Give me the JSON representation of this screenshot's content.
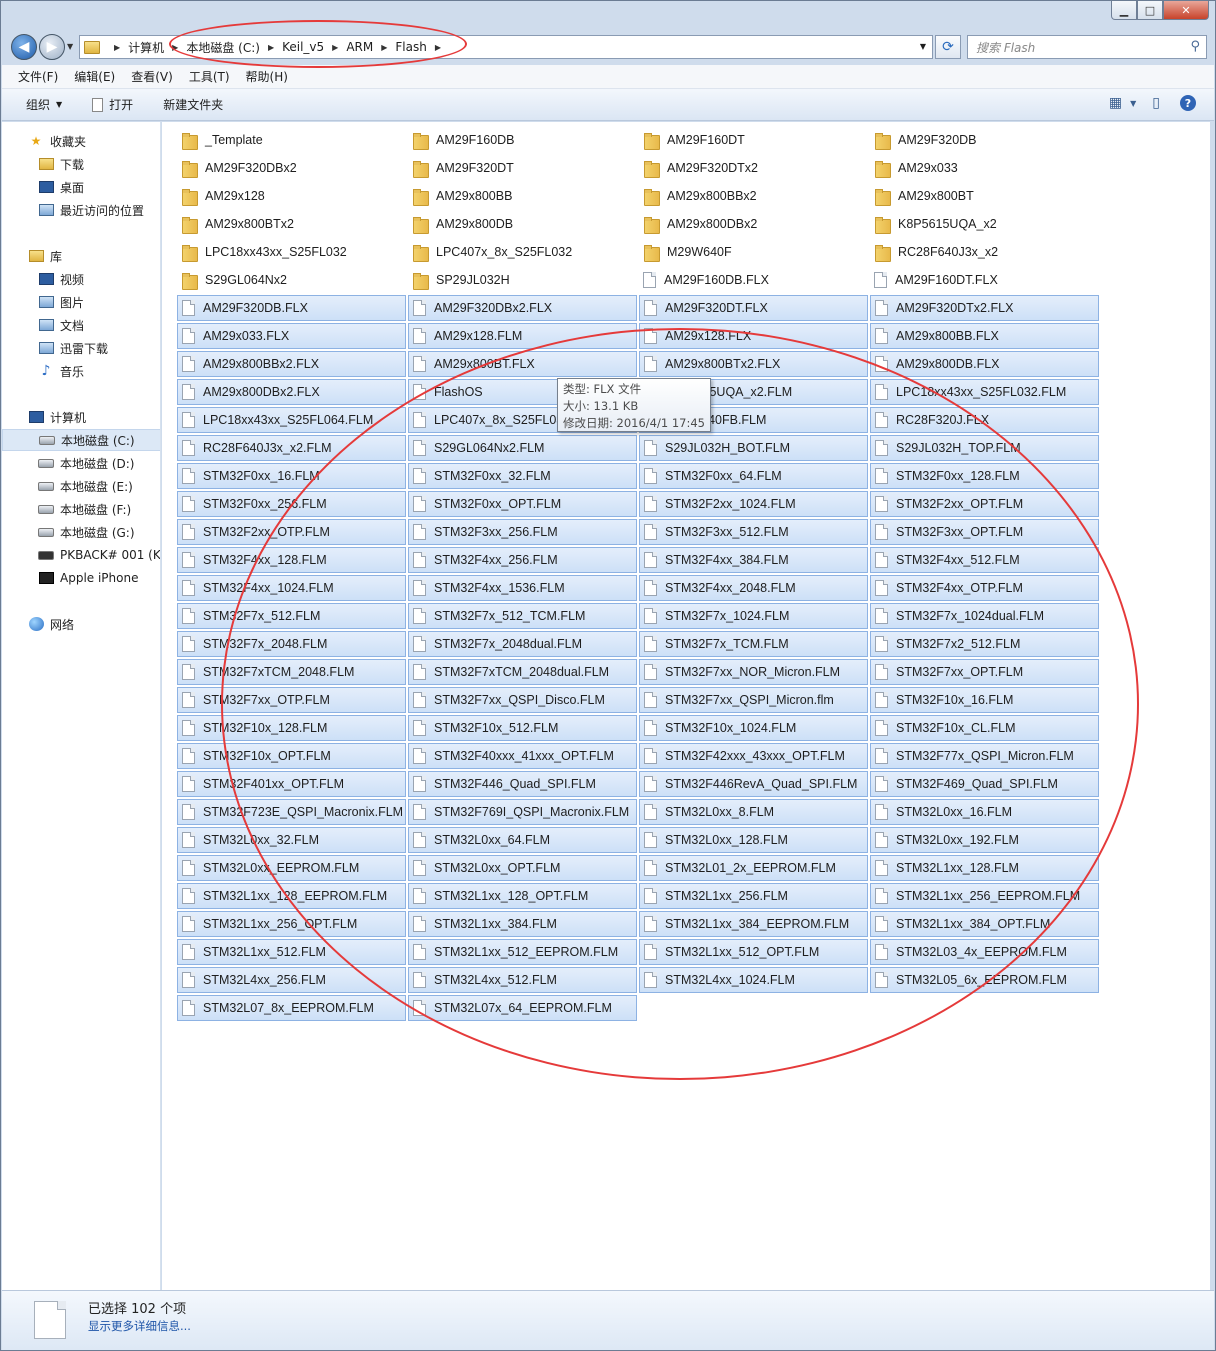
{
  "window": {
    "minimize": "▁",
    "maximize": "□",
    "close": "✕"
  },
  "address": {
    "crumbs": [
      "计算机",
      "本地磁盘 (C:)",
      "Keil_v5",
      "ARM",
      "Flash"
    ]
  },
  "search": {
    "placeholder": "搜索 Flash"
  },
  "menu": [
    "文件(F)",
    "编辑(E)",
    "查看(V)",
    "工具(T)",
    "帮助(H)"
  ],
  "toolbar": {
    "organize": "组织",
    "open": "打开",
    "new_folder": "新建文件夹"
  },
  "sidebar": {
    "favorites": "收藏夹",
    "downloads": "下载",
    "desktop": "桌面",
    "recent": "最近访问的位置",
    "libraries": "库",
    "videos": "视频",
    "pictures": "图片",
    "documents": "文档",
    "thunder": "迅雷下载",
    "music": "音乐",
    "computer": "计算机",
    "drive_c": "本地磁盘 (C:)",
    "drive_d": "本地磁盘 (D:)",
    "drive_e": "本地磁盘 (E:)",
    "drive_f": "本地磁盘 (F:)",
    "drive_g": "本地磁盘 (G:)",
    "pkback": "PKBACK# 001 (K:",
    "iphone": "Apple iPhone",
    "network": "网络"
  },
  "files": [
    {
      "name": "_Template",
      "type": "folder",
      "selected": false
    },
    {
      "name": "AM29F160DB",
      "type": "folder",
      "selected": false
    },
    {
      "name": "AM29F160DT",
      "type": "folder",
      "selected": false
    },
    {
      "name": "AM29F320DB",
      "type": "folder",
      "selected": false
    },
    {
      "name": "AM29F320DBx2",
      "type": "folder",
      "selected": false
    },
    {
      "name": "AM29F320DT",
      "type": "folder",
      "selected": false
    },
    {
      "name": "AM29F320DTx2",
      "type": "folder",
      "selected": false
    },
    {
      "name": "AM29x033",
      "type": "folder",
      "selected": false
    },
    {
      "name": "AM29x128",
      "type": "folder",
      "selected": false
    },
    {
      "name": "AM29x800BB",
      "type": "folder",
      "selected": false
    },
    {
      "name": "AM29x800BBx2",
      "type": "folder",
      "selected": false
    },
    {
      "name": "AM29x800BT",
      "type": "folder",
      "selected": false
    },
    {
      "name": "AM29x800BTx2",
      "type": "folder",
      "selected": false
    },
    {
      "name": "AM29x800DB",
      "type": "folder",
      "selected": false
    },
    {
      "name": "AM29x800DBx2",
      "type": "folder",
      "selected": false
    },
    {
      "name": "K8P5615UQA_x2",
      "type": "folder",
      "selected": false
    },
    {
      "name": "LPC18xx43xx_S25FL032",
      "type": "folder",
      "selected": false
    },
    {
      "name": "LPC407x_8x_S25FL032",
      "type": "folder",
      "selected": false
    },
    {
      "name": "M29W640F",
      "type": "folder",
      "selected": false
    },
    {
      "name": "RC28F640J3x_x2",
      "type": "folder",
      "selected": false
    },
    {
      "name": "S29GL064Nx2",
      "type": "folder",
      "selected": false
    },
    {
      "name": "SP29JL032H",
      "type": "folder",
      "selected": false
    },
    {
      "name": "AM29F160DB.FLX",
      "type": "file",
      "selected": false
    },
    {
      "name": "AM29F160DT.FLX",
      "type": "file",
      "selected": false
    },
    {
      "name": "AM29F320DB.FLX",
      "type": "file",
      "selected": true
    },
    {
      "name": "AM29F320DBx2.FLX",
      "type": "file",
      "selected": true
    },
    {
      "name": "AM29F320DT.FLX",
      "type": "file",
      "selected": true
    },
    {
      "name": "AM29F320DTx2.FLX",
      "type": "file",
      "selected": true
    },
    {
      "name": "AM29x033.FLX",
      "type": "file",
      "selected": true
    },
    {
      "name": "AM29x128.FLM",
      "type": "file",
      "selected": true
    },
    {
      "name": "AM29x128.FLX",
      "type": "file",
      "selected": true
    },
    {
      "name": "AM29x800BB.FLX",
      "type": "file",
      "selected": true
    },
    {
      "name": "AM29x800BBx2.FLX",
      "type": "file",
      "selected": true
    },
    {
      "name": "AM29x800BT.FLX",
      "type": "file",
      "selected": true
    },
    {
      "name": "AM29x800BTx2.FLX",
      "type": "file",
      "selected": true
    },
    {
      "name": "AM29x800DB.FLX",
      "type": "file",
      "selected": true
    },
    {
      "name": "AM29x800DBx2.FLX",
      "type": "file",
      "selected": true
    },
    {
      "name": "FlashOS",
      "type": "file",
      "selected": true
    },
    {
      "name": "K8P5615UQA_x2.FLM",
      "type": "file",
      "selected": true
    },
    {
      "name": "LPC18xx43xx_S25FL032.FLM",
      "type": "file",
      "selected": true
    },
    {
      "name": "LPC18xx43xx_S25FL064.FLM",
      "type": "file",
      "selected": true
    },
    {
      "name": "LPC407x_8x_S25FL032.FLM",
      "type": "file",
      "selected": true
    },
    {
      "name": "M29W640FB.FLM",
      "type": "file",
      "selected": true
    },
    {
      "name": "RC28F320J.FLX",
      "type": "file",
      "selected": true
    },
    {
      "name": "RC28F640J3x_x2.FLM",
      "type": "file",
      "selected": true
    },
    {
      "name": "S29GL064Nx2.FLM",
      "type": "file",
      "selected": true
    },
    {
      "name": "S29JL032H_BOT.FLM",
      "type": "file",
      "selected": true
    },
    {
      "name": "S29JL032H_TOP.FLM",
      "type": "file",
      "selected": true
    },
    {
      "name": "STM32F0xx_16.FLM",
      "type": "file",
      "selected": true
    },
    {
      "name": "STM32F0xx_32.FLM",
      "type": "file",
      "selected": true
    },
    {
      "name": "STM32F0xx_64.FLM",
      "type": "file",
      "selected": true
    },
    {
      "name": "STM32F0xx_128.FLM",
      "type": "file",
      "selected": true
    },
    {
      "name": "STM32F0xx_256.FLM",
      "type": "file",
      "selected": true
    },
    {
      "name": "STM32F0xx_OPT.FLM",
      "type": "file",
      "selected": true
    },
    {
      "name": "STM32F2xx_1024.FLM",
      "type": "file",
      "selected": true
    },
    {
      "name": "STM32F2xx_OPT.FLM",
      "type": "file",
      "selected": true
    },
    {
      "name": "STM32F2xx_OTP.FLM",
      "type": "file",
      "selected": true
    },
    {
      "name": "STM32F3xx_256.FLM",
      "type": "file",
      "selected": true
    },
    {
      "name": "STM32F3xx_512.FLM",
      "type": "file",
      "selected": true
    },
    {
      "name": "STM32F3xx_OPT.FLM",
      "type": "file",
      "selected": true
    },
    {
      "name": "STM32F4xx_128.FLM",
      "type": "file",
      "selected": true
    },
    {
      "name": "STM32F4xx_256.FLM",
      "type": "file",
      "selected": true
    },
    {
      "name": "STM32F4xx_384.FLM",
      "type": "file",
      "selected": true
    },
    {
      "name": "STM32F4xx_512.FLM",
      "type": "file",
      "selected": true
    },
    {
      "name": "STM32F4xx_1024.FLM",
      "type": "file",
      "selected": true
    },
    {
      "name": "STM32F4xx_1536.FLM",
      "type": "file",
      "selected": true
    },
    {
      "name": "STM32F4xx_2048.FLM",
      "type": "file",
      "selected": true
    },
    {
      "name": "STM32F4xx_OTP.FLM",
      "type": "file",
      "selected": true
    },
    {
      "name": "STM32F7x_512.FLM",
      "type": "file",
      "selected": true
    },
    {
      "name": "STM32F7x_512_TCM.FLM",
      "type": "file",
      "selected": true
    },
    {
      "name": "STM32F7x_1024.FLM",
      "type": "file",
      "selected": true
    },
    {
      "name": "STM32F7x_1024dual.FLM",
      "type": "file",
      "selected": true
    },
    {
      "name": "STM32F7x_2048.FLM",
      "type": "file",
      "selected": true
    },
    {
      "name": "STM32F7x_2048dual.FLM",
      "type": "file",
      "selected": true
    },
    {
      "name": "STM32F7x_TCM.FLM",
      "type": "file",
      "selected": true
    },
    {
      "name": "STM32F7x2_512.FLM",
      "type": "file",
      "selected": true
    },
    {
      "name": "STM32F7xTCM_2048.FLM",
      "type": "file",
      "selected": true
    },
    {
      "name": "STM32F7xTCM_2048dual.FLM",
      "type": "file",
      "selected": true
    },
    {
      "name": "STM32F7xx_NOR_Micron.FLM",
      "type": "file",
      "selected": true
    },
    {
      "name": "STM32F7xx_OPT.FLM",
      "type": "file",
      "selected": true
    },
    {
      "name": "STM32F7xx_OTP.FLM",
      "type": "file",
      "selected": true
    },
    {
      "name": "STM32F7xx_QSPI_Disco.FLM",
      "type": "file",
      "selected": true
    },
    {
      "name": "STM32F7xx_QSPI_Micron.flm",
      "type": "file",
      "selected": true
    },
    {
      "name": "STM32F10x_16.FLM",
      "type": "file",
      "selected": true
    },
    {
      "name": "STM32F10x_128.FLM",
      "type": "file",
      "selected": true
    },
    {
      "name": "STM32F10x_512.FLM",
      "type": "file",
      "selected": true
    },
    {
      "name": "STM32F10x_1024.FLM",
      "type": "file",
      "selected": true
    },
    {
      "name": "STM32F10x_CL.FLM",
      "type": "file",
      "selected": true
    },
    {
      "name": "STM32F10x_OPT.FLM",
      "type": "file",
      "selected": true
    },
    {
      "name": "STM32F40xxx_41xxx_OPT.FLM",
      "type": "file",
      "selected": true
    },
    {
      "name": "STM32F42xxx_43xxx_OPT.FLM",
      "type": "file",
      "selected": true
    },
    {
      "name": "STM32F77x_QSPI_Micron.FLM",
      "type": "file",
      "selected": true
    },
    {
      "name": "STM32F401xx_OPT.FLM",
      "type": "file",
      "selected": true
    },
    {
      "name": "STM32F446_Quad_SPI.FLM",
      "type": "file",
      "selected": true
    },
    {
      "name": "STM32F446RevA_Quad_SPI.FLM",
      "type": "file",
      "selected": true
    },
    {
      "name": "STM32F469_Quad_SPI.FLM",
      "type": "file",
      "selected": true
    },
    {
      "name": "STM32F723E_QSPI_Macronix.FLM",
      "type": "file",
      "selected": true
    },
    {
      "name": "STM32F769I_QSPI_Macronix.FLM",
      "type": "file",
      "selected": true
    },
    {
      "name": "STM32L0xx_8.FLM",
      "type": "file",
      "selected": true
    },
    {
      "name": "STM32L0xx_16.FLM",
      "type": "file",
      "selected": true
    },
    {
      "name": "STM32L0xx_32.FLM",
      "type": "file",
      "selected": true
    },
    {
      "name": "STM32L0xx_64.FLM",
      "type": "file",
      "selected": true
    },
    {
      "name": "STM32L0xx_128.FLM",
      "type": "file",
      "selected": true
    },
    {
      "name": "STM32L0xx_192.FLM",
      "type": "file",
      "selected": true
    },
    {
      "name": "STM32L0xx_EEPROM.FLM",
      "type": "file",
      "selected": true
    },
    {
      "name": "STM32L0xx_OPT.FLM",
      "type": "file",
      "selected": true
    },
    {
      "name": "STM32L01_2x_EEPROM.FLM",
      "type": "file",
      "selected": true
    },
    {
      "name": "STM32L1xx_128.FLM",
      "type": "file",
      "selected": true
    },
    {
      "name": "STM32L1xx_128_EEPROM.FLM",
      "type": "file",
      "selected": true
    },
    {
      "name": "STM32L1xx_128_OPT.FLM",
      "type": "file",
      "selected": true
    },
    {
      "name": "STM32L1xx_256.FLM",
      "type": "file",
      "selected": true
    },
    {
      "name": "STM32L1xx_256_EEPROM.FLM",
      "type": "file",
      "selected": true
    },
    {
      "name": "STM32L1xx_256_OPT.FLM",
      "type": "file",
      "selected": true
    },
    {
      "name": "STM32L1xx_384.FLM",
      "type": "file",
      "selected": true
    },
    {
      "name": "STM32L1xx_384_EEPROM.FLM",
      "type": "file",
      "selected": true
    },
    {
      "name": "STM32L1xx_384_OPT.FLM",
      "type": "file",
      "selected": true
    },
    {
      "name": "STM32L1xx_512.FLM",
      "type": "file",
      "selected": true
    },
    {
      "name": "STM32L1xx_512_EEPROM.FLM",
      "type": "file",
      "selected": true
    },
    {
      "name": "STM32L1xx_512_OPT.FLM",
      "type": "file",
      "selected": true
    },
    {
      "name": "STM32L03_4x_EEPROM.FLM",
      "type": "file",
      "selected": true
    },
    {
      "name": "STM32L4xx_256.FLM",
      "type": "file",
      "selected": true
    },
    {
      "name": "STM32L4xx_512.FLM",
      "type": "file",
      "selected": true
    },
    {
      "name": "STM32L4xx_1024.FLM",
      "type": "file",
      "selected": true
    },
    {
      "name": "STM32L05_6x_EEPROM.FLM",
      "type": "file",
      "selected": true
    },
    {
      "name": "STM32L07_8x_EEPROM.FLM",
      "type": "file",
      "selected": true
    },
    {
      "name": "STM32L07x_64_EEPROM.FLM",
      "type": "file",
      "selected": true
    }
  ],
  "tooltip": {
    "type": "类型: FLX 文件",
    "size": "大小: 13.1 KB",
    "modified": "修改日期: 2016/4/1 17:45"
  },
  "details": {
    "selection": "已选择 102 个项",
    "more": "显示更多详细信息..."
  }
}
